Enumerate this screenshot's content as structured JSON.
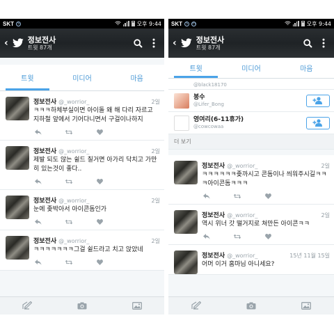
{
  "status": {
    "carrier": "SKT",
    "time": "오후 9:44"
  },
  "left": {
    "header": {
      "title": "정보전사",
      "subtitle": "트윗 87개"
    },
    "tabs": [
      "트윗",
      "미디어",
      "마음"
    ],
    "tweets": [
      {
        "name": "정보전사",
        "handle": "@_worrior_",
        "date": "2일",
        "text": "ㅋㅋㅋ하체부실이면 아이돌 왜 해 다리 자르고 지하철 앞에서 기어다니면서 구걸이나하지"
      },
      {
        "name": "정보전사",
        "handle": "@_worrior_",
        "date": "2일",
        "text": "제발 되도 않는 쉴드 칠거면 아가리 닥치고 가만히 있는것이 좋다.."
      },
      {
        "name": "정보전사",
        "handle": "@_worrior_",
        "date": "2일",
        "text": "눈에 좆박아서 아이콘돔인가"
      },
      {
        "name": "정보전사",
        "handle": "@_worrior_",
        "date": "2일",
        "text": "ㅋㅋㅋㅋㅋㅋㅋ그걸 쉴드라고 치고 앉았네"
      }
    ]
  },
  "right": {
    "header": {
      "title": "정보전사",
      "subtitle": "트윗 87개"
    },
    "tabs": [
      "트윗",
      "미디어",
      "마음"
    ],
    "follows": [
      {
        "name": "",
        "handle": "@black18170"
      },
      {
        "name": "봉수",
        "handle": "@Lifer_Bong"
      },
      {
        "name": "영여리(6-11휴가)",
        "handle": "@cowcowaa"
      }
    ],
    "more_label": "더 보기",
    "tweets": [
      {
        "name": "정보전사",
        "handle": "@_worrior_",
        "date": "2일",
        "text": "ㅋㅋㅋㅋㅋㅋ좆까시고 콘돔이나 씌워주시길ㅋㅋㅋ아이콘돔ㅋㅋㅋ"
      },
      {
        "name": "정보전사",
        "handle": "@_worrior_",
        "date": "2일",
        "text": "역시 위너 갓 떨거지로 쳐만든 아이콘ㅋㅋ"
      },
      {
        "name": "정보전사",
        "handle": "@_worrior_",
        "date": "15년 11월 15일",
        "text": "어머 이거 홈마님 아니세요?"
      }
    ]
  },
  "icons": {
    "back": "arrow-left-icon",
    "logo": "twitter-bird-icon",
    "search": "search-icon",
    "menu": "more-vertical-icon",
    "reply": "reply-icon",
    "retweet": "retweet-icon",
    "like": "heart-icon",
    "compose": "compose-icon",
    "camera": "camera-icon",
    "image": "image-icon",
    "follow": "add-user-icon"
  },
  "colors": {
    "accent": "#4aa3e8",
    "header_bg": "#23272a",
    "background": "#f4f7f9"
  }
}
